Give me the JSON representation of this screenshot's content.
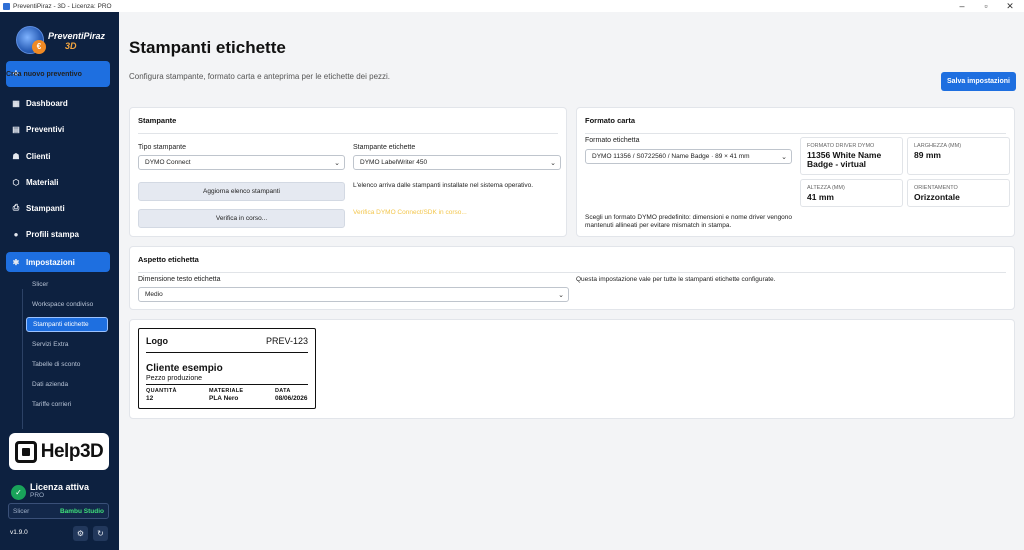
{
  "window": {
    "title": "PreventiPiraz - 3D - Licenza: PRO"
  },
  "brand": {
    "name": "PreventiPiraz",
    "suffix": "3D",
    "coin": "€"
  },
  "sidebar": {
    "new_quote": "Crea nuovo preventivo",
    "items": [
      {
        "label": "Dashboard",
        "icon": "grid-icon",
        "glyph": "▦"
      },
      {
        "label": "Preventivi",
        "icon": "document-icon",
        "glyph": "▤"
      },
      {
        "label": "Clienti",
        "icon": "users-icon",
        "glyph": "☗"
      },
      {
        "label": "Materiali",
        "icon": "cube-icon",
        "glyph": "⬡"
      },
      {
        "label": "Stampanti",
        "icon": "printer-icon",
        "glyph": "⎙"
      },
      {
        "label": "Profili stampa",
        "icon": "user-icon",
        "glyph": "●"
      },
      {
        "label": "Impostazioni",
        "icon": "gear-icon",
        "glyph": "✱"
      }
    ],
    "subitems": [
      "Slicer",
      "Workspace condiviso",
      "Stampanti etichette",
      "Servizi Extra",
      "Tabelle di sconto",
      "Dati azienda",
      "Tariffe corrieri"
    ],
    "help_label": "Help3D",
    "license_title": "Licenza attiva",
    "license_type": "PRO",
    "slicer_key": "Slicer",
    "slicer_value": "Bambu Studio",
    "version": "v1.9.0"
  },
  "page": {
    "title": "Stampanti etichette",
    "subtitle": "Configura stampante, formato carta e anteprima per le etichette dei pezzi.",
    "save_button": "Salva impostazioni"
  },
  "printer_card": {
    "title": "Stampante",
    "type_label": "Tipo stampante",
    "type_value": "DYMO Connect",
    "label_printer_label": "Stampante etichette",
    "label_printer_value": "DYMO LabelWriter 450",
    "refresh_button": "Aggiorna elenco stampanti",
    "verify_button": "Verifica in corso...",
    "list_note": "L'elenco arriva dalle stampanti installate nel sistema operativo.",
    "verify_status": "Verifica DYMO Connect/SDK in corso..."
  },
  "paper_card": {
    "title": "Formato carta",
    "format_label": "Formato etichetta",
    "format_value": "DYMO 11356 / S0722560 / Name Badge · 89 × 41 mm",
    "note": "Scegli un formato DYMO predefinito: dimensioni e nome driver vengono mantenuti allineati per evitare mismatch in stampa.",
    "stats": [
      {
        "key": "Formato driver DYMO",
        "value": "11356 White Name Badge - virtual"
      },
      {
        "key": "Larghezza (mm)",
        "value": "89 mm"
      },
      {
        "key": "Altezza (mm)",
        "value": "41 mm"
      },
      {
        "key": "Orientamento",
        "value": "Orizzontale"
      }
    ]
  },
  "aspect_card": {
    "title": "Aspetto etichetta",
    "size_label": "Dimensione testo etichetta",
    "size_value": "Medio",
    "note": "Questa impostazione vale per tutte le stampanti etichette configurate."
  },
  "preview": {
    "logo": "Logo",
    "code": "PREV-123",
    "customer": "Cliente esempio",
    "part": "Pezzo produzione",
    "fields": [
      {
        "key": "QUANTITÀ",
        "value": "12"
      },
      {
        "key": "MATERIALE",
        "value": "PLA Nero"
      },
      {
        "key": "DATA",
        "value": "08/06/2026"
      }
    ]
  },
  "colors": {
    "sidebar": "#0d2140",
    "accent": "#1e6fe0",
    "warning": "#f3c64c",
    "license_ok": "#19a35a"
  }
}
